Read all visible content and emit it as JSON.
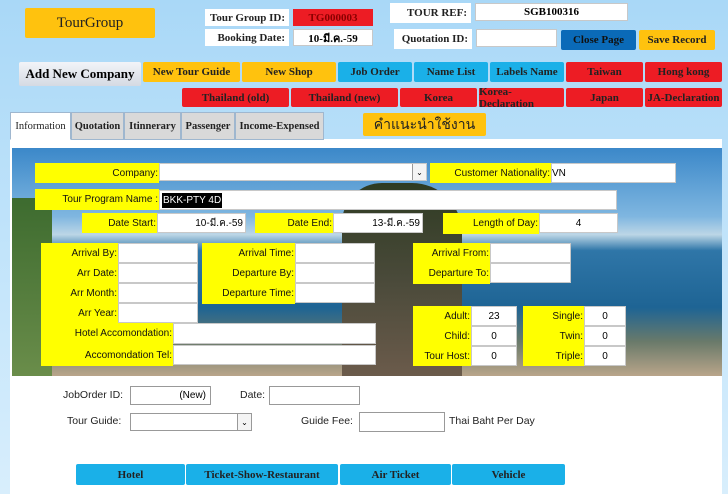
{
  "header": {
    "app_button": "TourGroup",
    "tour_group_id_label": "Tour Group ID:",
    "tour_group_id": "TG000003",
    "booking_date_label": "Booking Date:",
    "booking_date": "10-มี.ค.-59",
    "tour_ref_label": "TOUR REF:",
    "tour_ref": "SGB100316",
    "quotation_id_label": "Quotation ID:",
    "quotation_id": "",
    "close_page": "Close Page",
    "save_record": "Save Record"
  },
  "toolbar": {
    "add_company": "Add New Company",
    "row1": [
      "New Tour Guide",
      "New Shop",
      "Job Order",
      "Name List",
      "Labels Name",
      "Taiwan",
      "Hong kong"
    ],
    "row2": [
      "Thailand (old)",
      "Thailand (new)",
      "Korea",
      "Korea-Declaration",
      "Japan",
      "JA-Declaration"
    ]
  },
  "tabs": [
    "Information",
    "Quotation",
    "Itinnerary",
    "Passenger",
    "Income-Expensed"
  ],
  "help_button": "คำแนะนำใช้งาน",
  "form": {
    "company_label": "Company:",
    "company": "",
    "nationality_label": "Customer Nationality:",
    "nationality": "VN",
    "program_label": "Tour Program Name :",
    "program": "BKK-PTY 4D",
    "date_start_label": "Date Start:",
    "date_start": "10-มี.ค.-59",
    "date_end_label": "Date End:",
    "date_end": "13-มี.ค.-59",
    "length_label": "Length of Day:",
    "length": "4",
    "arrival_by": "Arrival By:",
    "arr_date": "Arr Date:",
    "arr_month": "Arr Month:",
    "arr_year": "Arr Year:",
    "hotel": "Hotel Accomondation:",
    "hotel_tel": "Accomondation Tel:",
    "arrival_time": "Arrival Time:",
    "departure_by": "Departure By:",
    "departure_time": "Departure Time:",
    "arrival_from": "Arrival From:",
    "departure_to": "Departure To:",
    "adult_label": "Adult:",
    "adult": "23",
    "child_label": "Child:",
    "child": "0",
    "host_label": "Tour Host:",
    "host": "0",
    "single_label": "Single:",
    "single": "0",
    "twin_label": "Twin:",
    "twin": "0",
    "triple_label": "Triple:",
    "triple": "0"
  },
  "job": {
    "id_label": "JobOrder ID:",
    "id": "(New)",
    "date_label": "Date:",
    "guide_label": "Tour Guide:",
    "fee_label": "Guide Fee:",
    "fee_unit": "Thai Baht Per Day"
  },
  "bottom_buttons": [
    "Hotel",
    "Ticket-Show-Restaurant",
    "Air Ticket",
    "Vehicle"
  ]
}
